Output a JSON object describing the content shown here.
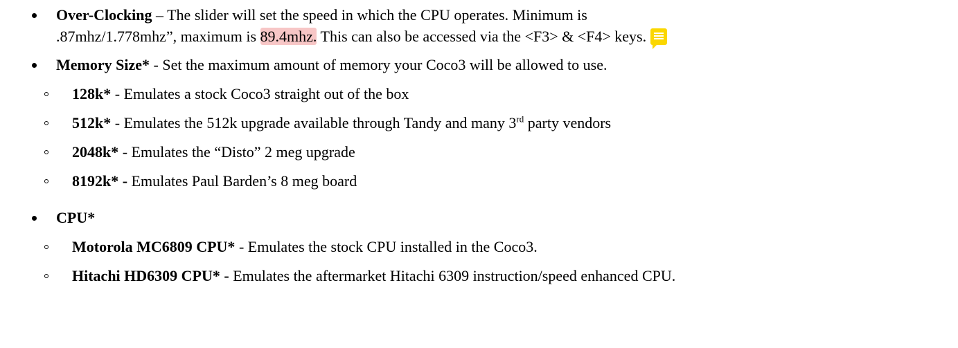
{
  "items": [
    {
      "title": "Over-Clocking",
      "sep": " – ",
      "line1": "The slider will set the speed in which the CPU operates. Minimum is",
      "line2_pre": ".87mhz/1.778mhz”, maximum is ",
      "line2_hl": "89.4mhz.",
      "line2_post": " This can also be accessed via the <F3> & <F4> keys.",
      "note_icon": "comment-note-icon"
    },
    {
      "title": "Memory Size*",
      "sep": " - ",
      "text": "Set the maximum amount of memory your Coco3 will be allowed to use.",
      "children": [
        {
          "title": "128k*",
          "sep": " - ",
          "text": "Emulates a stock Coco3 straight out of the box"
        },
        {
          "title": "512k*",
          "sep": " - ",
          "text_pre": "Emulates the 512k upgrade available through Tandy and many 3",
          "sup": "rd",
          "text_post": " party vendors"
        },
        {
          "title": "2048k*",
          "sep": " - ",
          "text": "Emulates the “Disto” 2 meg upgrade"
        },
        {
          "title": "8192k* -",
          "sep": " ",
          "text": "Emulates Paul Barden’s 8 meg board"
        }
      ]
    },
    {
      "title": "CPU*",
      "children": [
        {
          "title": "Motorola MC6809 CPU*",
          "sep": " - ",
          "text": "Emulates the stock CPU installed in the Coco3."
        },
        {
          "title": "Hitachi HD6309 CPU* -",
          "sep": " ",
          "text": "Emulates the aftermarket Hitachi 6309 instruction/speed enhanced CPU."
        }
      ]
    }
  ],
  "colors": {
    "highlight": "#f7c6c6",
    "note_icon": "#fbd700"
  }
}
